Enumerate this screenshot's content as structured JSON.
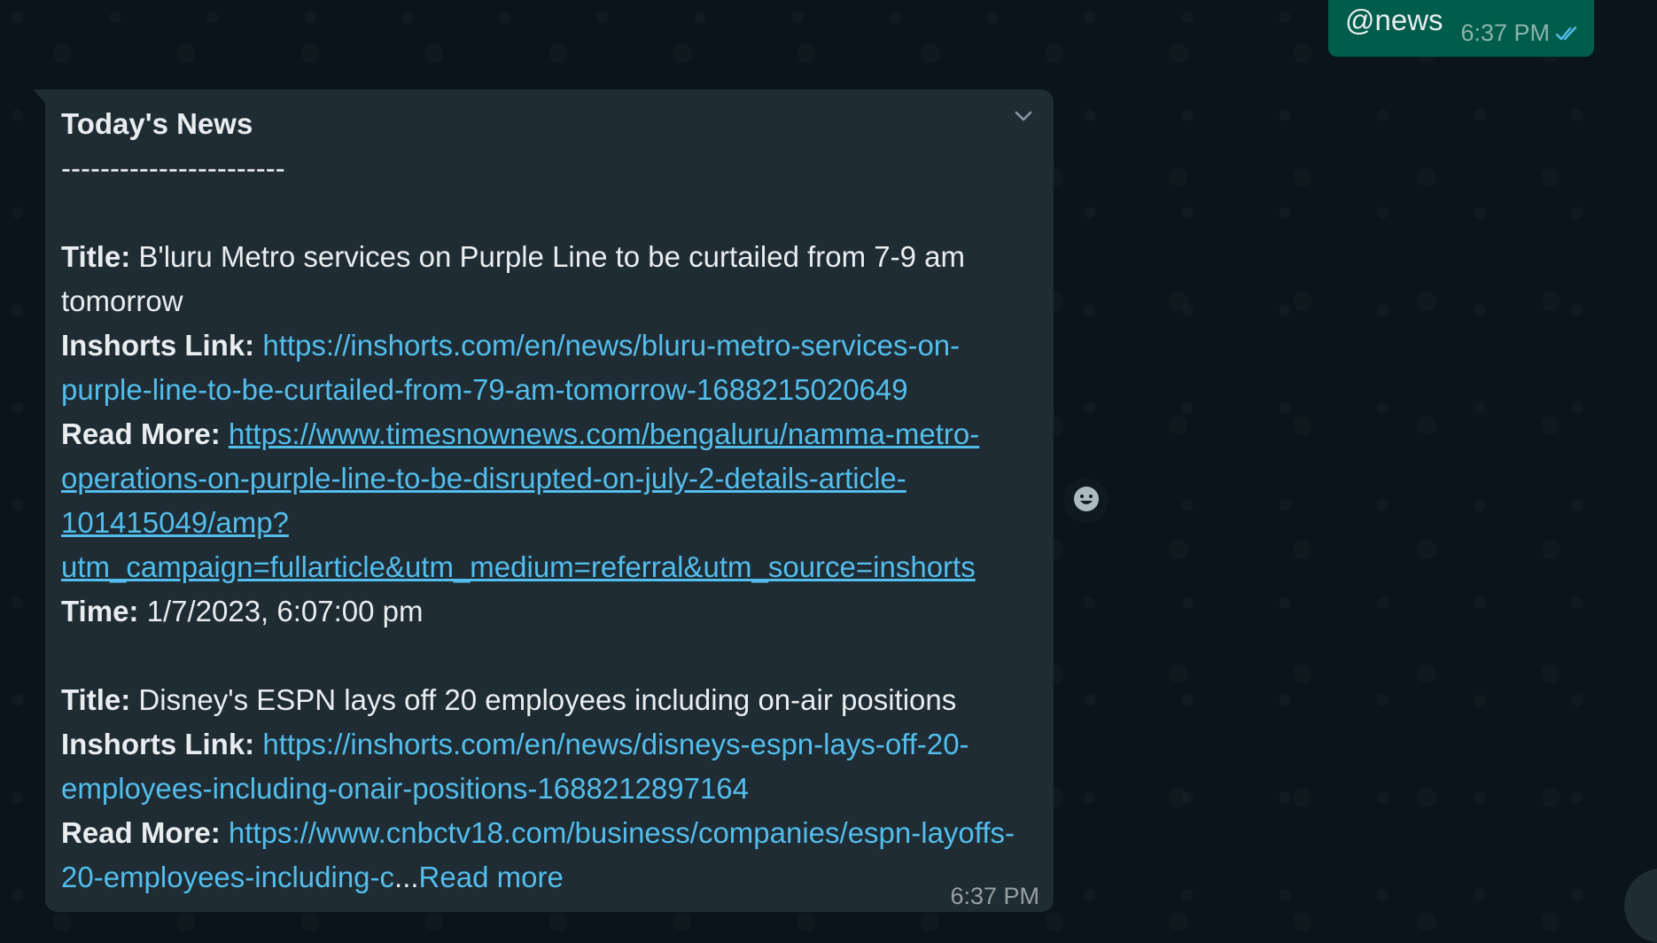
{
  "outgoing": {
    "text": "@news",
    "time": "6:37 PM",
    "status_icon": "double-check-read-icon",
    "bubble_color": "#005c4b"
  },
  "incoming": {
    "heading": "Today's News",
    "separator": "-----------------------",
    "articles": [
      {
        "title_label": "Title:",
        "title": "B'luru Metro services on Purple Line to be curtailed from 7-9 am tomorrow",
        "inshorts_label": "Inshorts Link:",
        "inshorts_link": "https://inshorts.com/en/news/bluru-metro-services-on-purple-line-to-be-curtailed-from-79-am-tomorrow-1688215020649",
        "readmore_label": "Read More:",
        "readmore_link": "https://www.timesnownews.com/bengaluru/namma-metro-operations-on-purple-line-to-be-disrupted-on-july-2-details-article-101415049/amp?utm_campaign=fullarticle&utm_medium=referral&utm_source=inshorts",
        "time_label": "Time:",
        "time": "1/7/2023, 6:07:00 pm"
      },
      {
        "title_label": "Title:",
        "title": "Disney's ESPN lays off 20 employees including on-air positions",
        "inshorts_label": "Inshorts Link:",
        "inshorts_link": "https://inshorts.com/en/news/disneys-espn-lays-off-20-employees-including-onair-positions-1688212897164",
        "readmore_label": "Read More:",
        "readmore_link": "https://www.cnbctv18.com/business/companies/espn-layoffs-20-employees-including-c",
        "truncation": "...",
        "read_more_toggle": "Read more"
      }
    ],
    "time": "6:37 PM",
    "bubble_color": "#1f2c34",
    "link_color": "#53bdeb"
  },
  "icons": {
    "menu": "chevron-down-icon",
    "react": "emoji-smile-icon",
    "scroll": "scroll-down-button"
  }
}
